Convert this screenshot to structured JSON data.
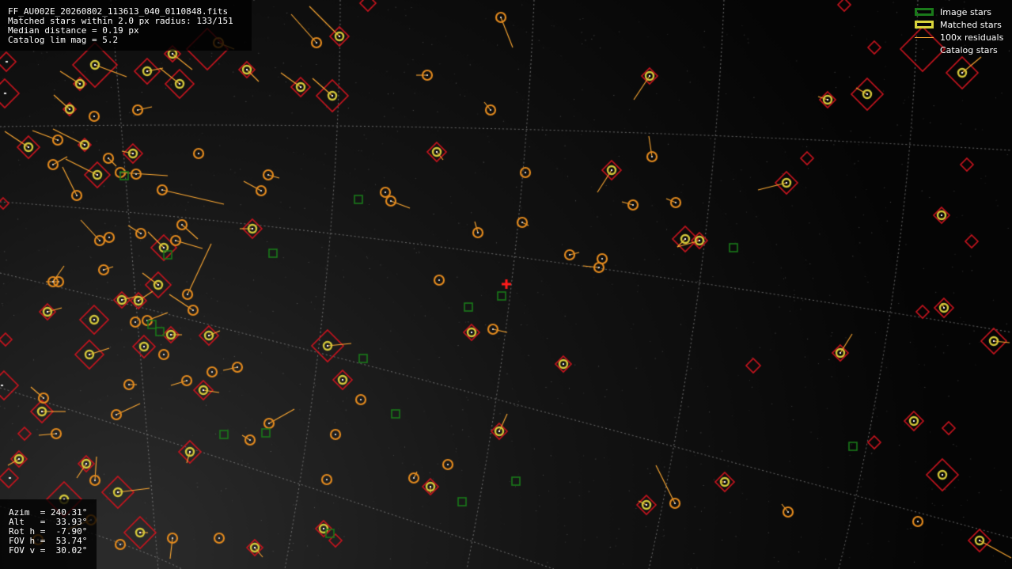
{
  "header": {
    "file_name": "FF_AU002E_20260802_113613_040_0110848.fits",
    "match_summary": "Matched stars within 2.0 px radius: 133/151",
    "median_distance": "Median distance = 0.19 px",
    "catalog_lim_mag": "Catalog lim mag = 5.2"
  },
  "legend": {
    "image_stars": "Image stars",
    "matched_stars": "Matched stars",
    "residuals": "100x residuals",
    "catalog_stars": "Catalog stars"
  },
  "pointing": {
    "azim": "Azim  = 240.31°",
    "alt": "Alt   =  33.93°",
    "rot": "Rot h =  -7.90°",
    "fov_h": "FOV h =  53.74°",
    "fov_v": "FOV v =  30.02°"
  },
  "colors": {
    "background": "#050505",
    "grid": "#8a8a8a",
    "catalog_diamond": "#c8141e",
    "matched_ring": "#d4c83a",
    "image_star_square": "#1a7a1a",
    "detection": "#e38a1e",
    "residual": "#ffaa33",
    "center_marker": "#ff1a1a"
  }
}
